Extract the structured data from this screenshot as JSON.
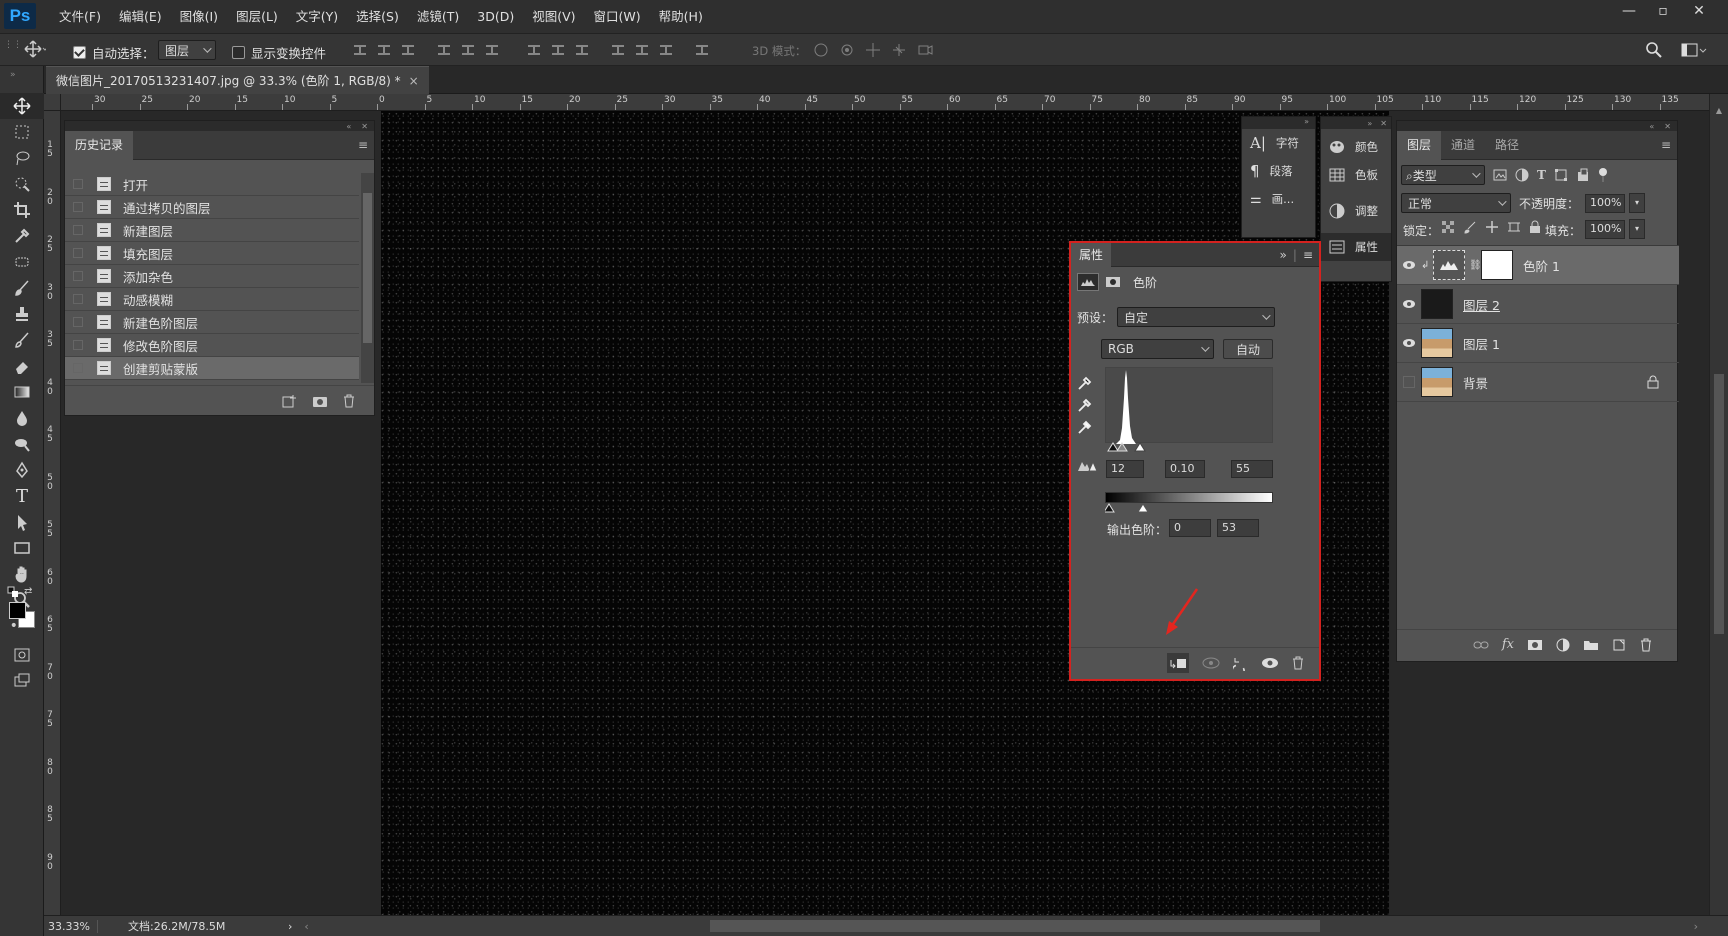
{
  "app": {
    "logo": "Ps"
  },
  "menu": [
    "文件(F)",
    "编辑(E)",
    "图像(I)",
    "图层(L)",
    "文字(Y)",
    "选择(S)",
    "滤镜(T)",
    "3D(D)",
    "视图(V)",
    "窗口(W)",
    "帮助(H)"
  ],
  "options": {
    "auto_select_label": "自动选择：",
    "auto_select_value": "图层",
    "show_transform_label": "显示变换控件",
    "mode_3d_label": "3D 模式："
  },
  "document": {
    "tab_title": "微信图片_20170513231407.jpg @ 33.3% (色阶 1, RGB/8) *",
    "close": "×"
  },
  "ruler": {
    "h_labels": [
      "30",
      "25",
      "20",
      "15",
      "10",
      "5",
      "0",
      "5",
      "10",
      "15",
      "20",
      "25",
      "30",
      "35",
      "40",
      "45",
      "50",
      "55",
      "60",
      "65",
      "70",
      "75",
      "80",
      "85",
      "90",
      "95",
      "100",
      "105",
      "110",
      "115",
      "120",
      "125",
      "130",
      "135"
    ],
    "v_labels": [
      "1 5",
      "2 0",
      "2 5",
      "3 0",
      "3 5",
      "4 0",
      "4 5",
      "5 0",
      "5 5",
      "6 0",
      "6 5",
      "7 0",
      "7 5",
      "8 0",
      "8 5",
      "9 0"
    ]
  },
  "history": {
    "tab": "历史记录",
    "items": [
      "打开",
      "通过拷贝的图层",
      "新建图层",
      "填充图层",
      "添加杂色",
      "动感模糊",
      "新建色阶图层",
      "修改色阶图层",
      "创建剪贴蒙版"
    ],
    "selected_index": 8
  },
  "mini_panels": {
    "group1": [
      "字符",
      "段落",
      "画..."
    ],
    "group2": [
      "颜色",
      "色板",
      "调整",
      "属性"
    ]
  },
  "properties": {
    "tab": "属性",
    "title": "色阶",
    "preset_label": "预设：",
    "preset_value": "自定",
    "channel": "RGB",
    "auto_btn": "自动",
    "input_black": "12",
    "input_gamma": "0.10",
    "input_white": "55",
    "output_label": "输出色阶：",
    "output_black": "0",
    "output_white": "53"
  },
  "layers": {
    "tabs": [
      "图层",
      "通道",
      "路径"
    ],
    "filter_kind": "类型",
    "blend_mode": "正常",
    "opacity_label": "不透明度：",
    "opacity": "100%",
    "lock_label": "锁定：",
    "fill_label": "填充：",
    "fill": "100%",
    "items": [
      {
        "name": "色阶 1",
        "visible": true
      },
      {
        "name": "图层 2",
        "visible": true
      },
      {
        "name": "图层 1",
        "visible": true
      },
      {
        "name": "背景",
        "visible": false
      }
    ]
  },
  "status": {
    "zoom": "33.33%",
    "doc": "文档:26.2M/78.5M"
  },
  "colors": {
    "highlight_border": "#d4221f",
    "arrow": "#e3261f",
    "ps_blue": "#31a8ff"
  }
}
